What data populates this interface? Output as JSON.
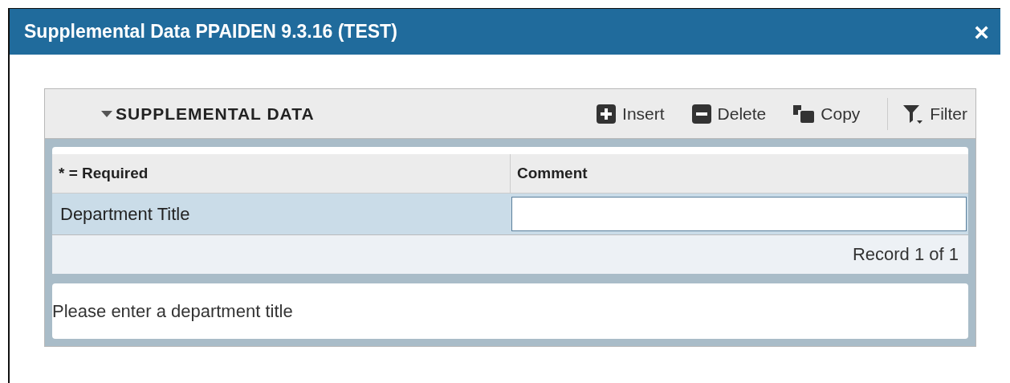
{
  "window": {
    "title": "Supplemental Data PPAIDEN 9.3.16 (TEST)",
    "close": "×"
  },
  "section": {
    "title": "SUPPLEMENTAL DATA",
    "expanded": true,
    "toolbar": [
      {
        "kind": "insert",
        "label": "Insert"
      },
      {
        "kind": "delete",
        "label": "Delete"
      },
      {
        "kind": "copy",
        "label": "Copy"
      },
      {
        "kind": "filter",
        "label": "Filter"
      }
    ]
  },
  "table": {
    "columns": [
      "* = Required",
      "Comment"
    ],
    "rows": [
      {
        "label": "Department Title",
        "comment": "",
        "selected": true
      }
    ],
    "record": "Record 1 of 1"
  },
  "hint": "Please enter a department title"
}
